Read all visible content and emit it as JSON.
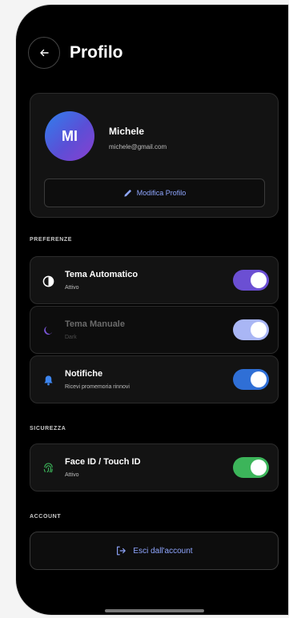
{
  "header": {
    "title": "Profilo",
    "back_icon": "arrow-left-icon"
  },
  "profile": {
    "initials": "MI",
    "name": "Michele",
    "email": "michele@gmail.com",
    "edit_label": "Modifica Profilo",
    "edit_icon": "pencil-icon"
  },
  "sections": {
    "preferences": "PREFERENZE",
    "security": "SICUREZZA",
    "account": "ACCOUNT"
  },
  "rows": {
    "auto_theme": {
      "title": "Tema Automatico",
      "subtitle": "Attivo",
      "icon": "contrast-icon",
      "toggle_on": true,
      "toggle_color": "#6b4fd3"
    },
    "manual_theme": {
      "title": "Tema Manuale",
      "subtitle": "Dark",
      "icon": "moon-icon",
      "toggle_on": true,
      "toggle_color": "#a9b6f5"
    },
    "notifications": {
      "title": "Notifiche",
      "subtitle": "Ricevi promemoria rinnovi",
      "icon": "bell-icon",
      "toggle_on": true,
      "toggle_color": "#2f6fd6"
    },
    "face_id": {
      "title": "Face ID / Touch ID",
      "subtitle": "Attivo",
      "icon": "fingerprint-icon",
      "toggle_on": true,
      "toggle_color": "#3cb55a"
    }
  },
  "logout": {
    "label": "Esci dall'account",
    "icon": "logout-icon"
  },
  "colors": {
    "accent": "#8fa6ff",
    "background": "#000000",
    "card": "#131313"
  }
}
